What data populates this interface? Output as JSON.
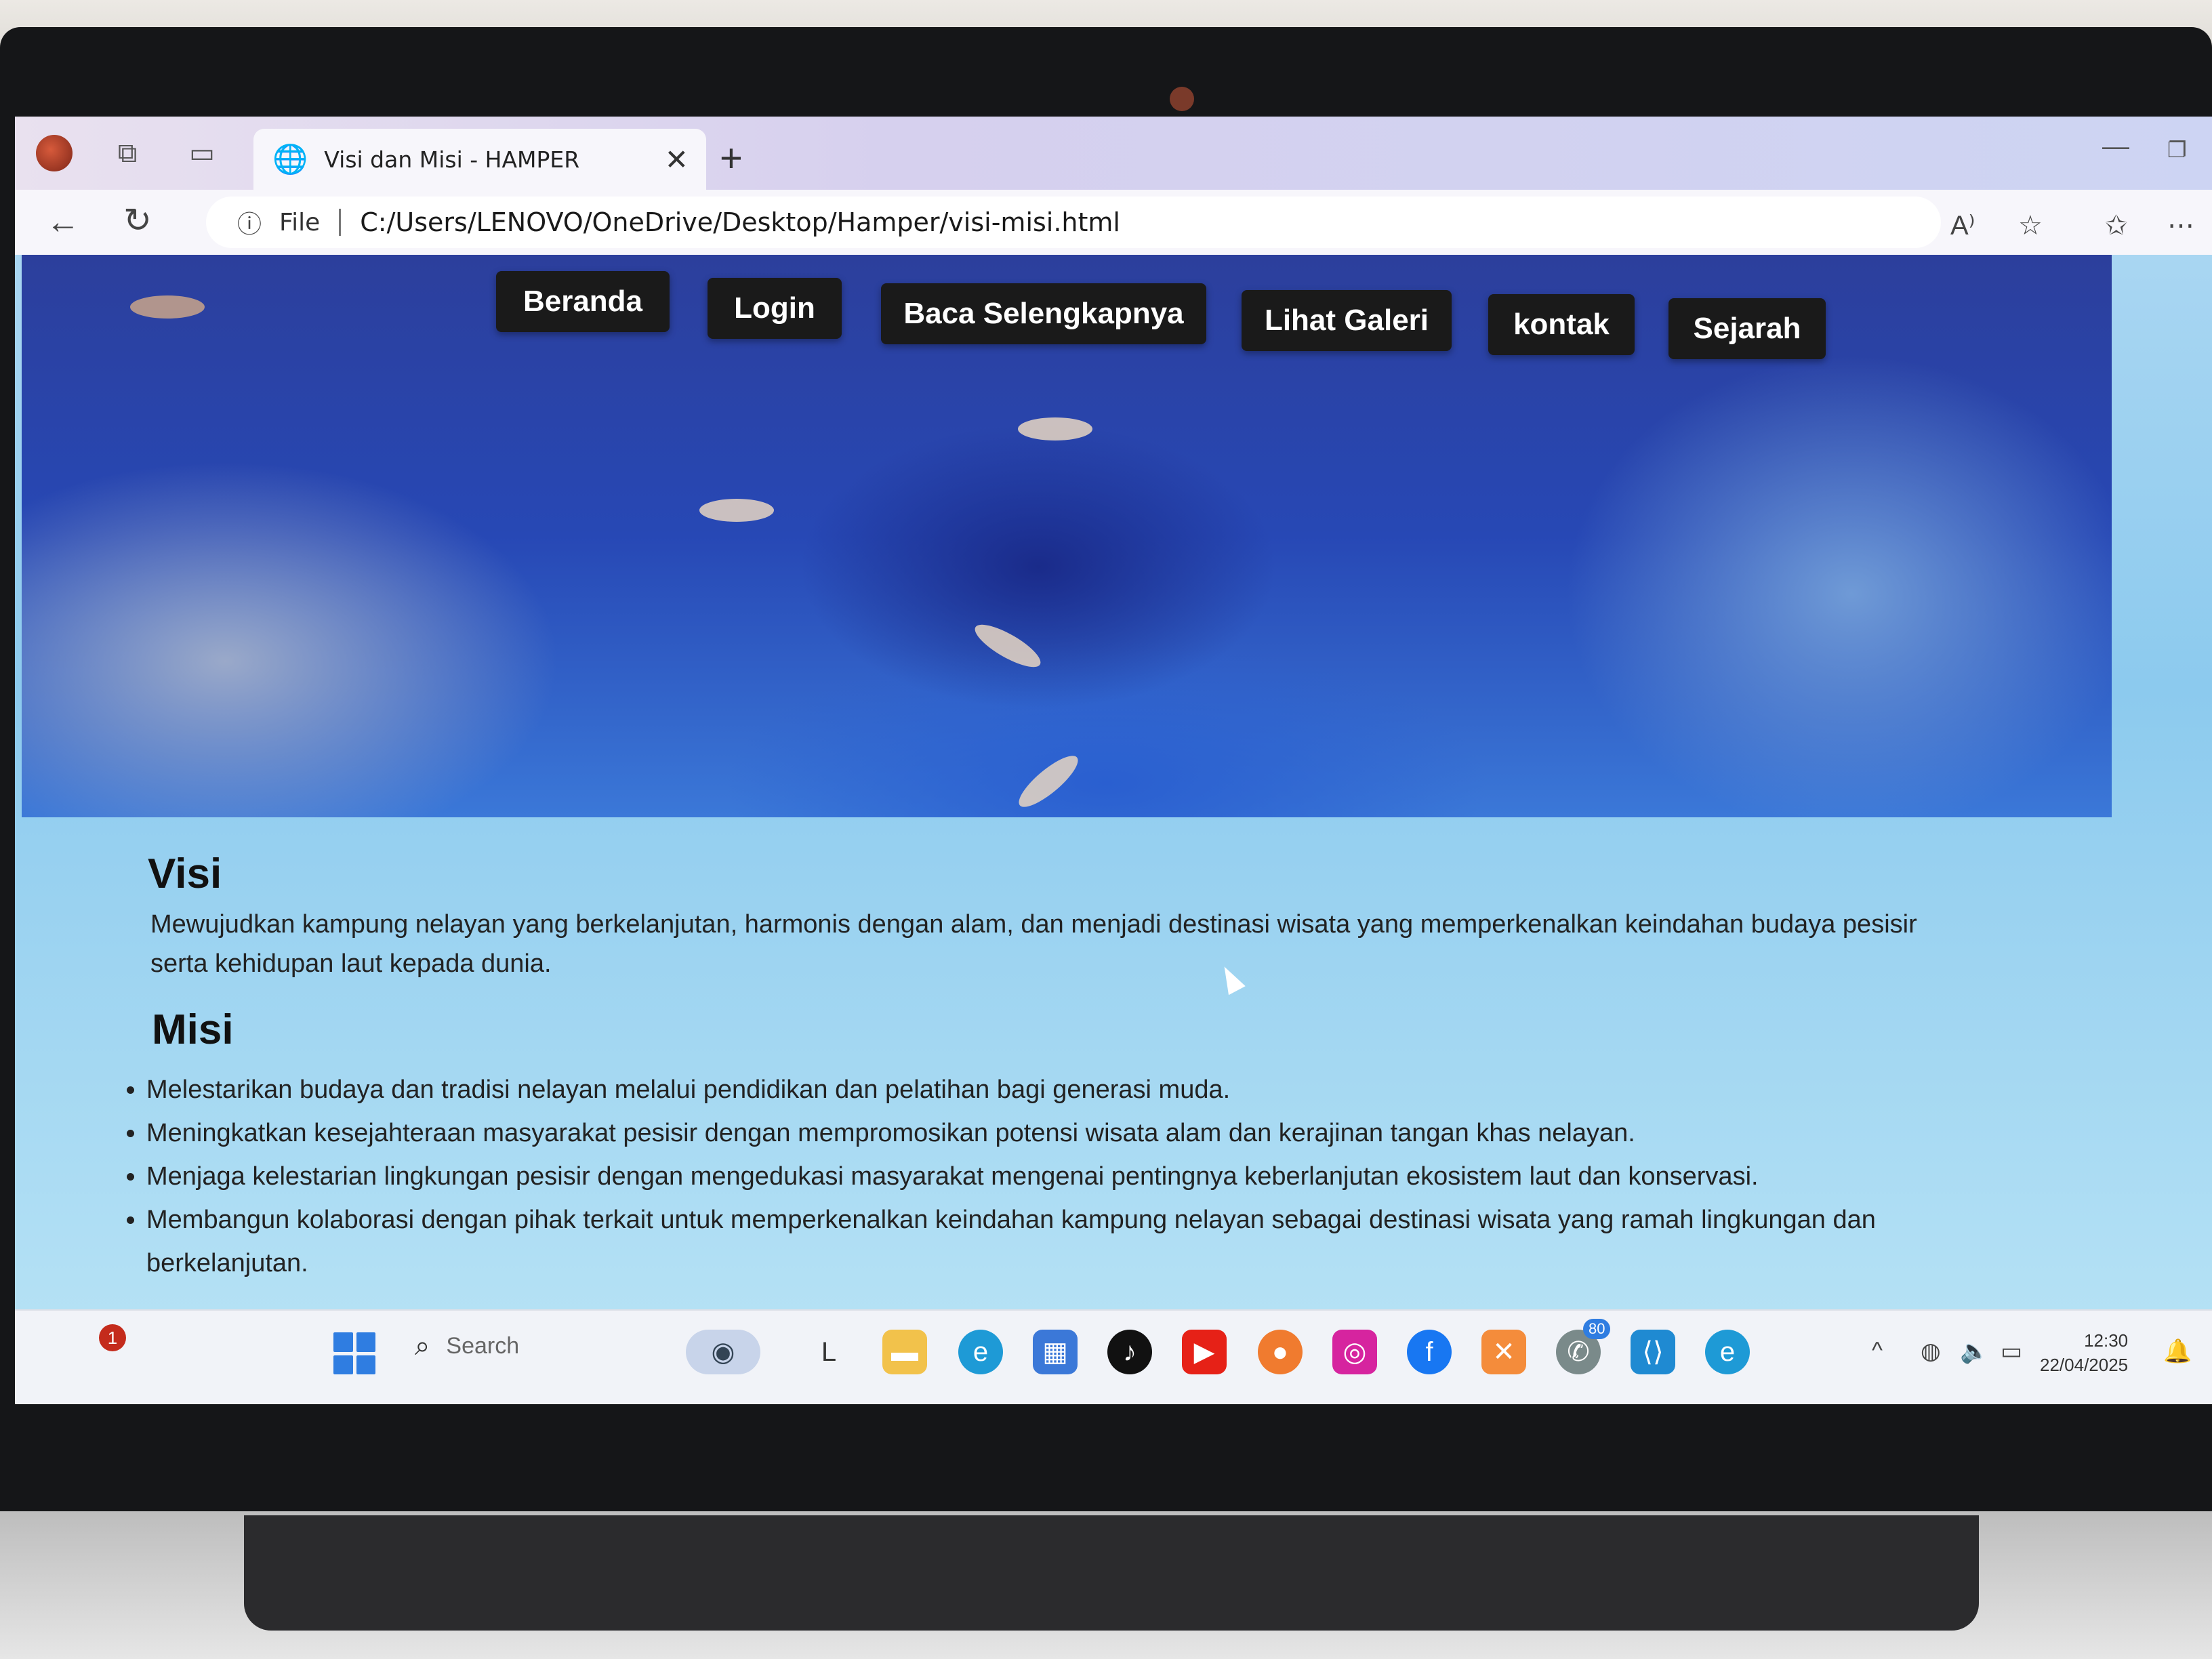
{
  "browser": {
    "tab_title": "Visi dan Misi - HAMPER",
    "scheme_label": "File",
    "url": "C:/Users/LENOVO/OneDrive/Desktop/Hamper/visi-misi.html"
  },
  "nav": {
    "items": [
      {
        "label": "Beranda"
      },
      {
        "label": "Login"
      },
      {
        "label": "Baca Selengkapnya"
      },
      {
        "label": "Lihat Galeri"
      },
      {
        "label": "kontak"
      },
      {
        "label": "Sejarah"
      }
    ]
  },
  "visi": {
    "heading": "Visi",
    "text_line1": "Mewujudkan kampung nelayan yang berkelanjutan, harmonis dengan alam, dan menjadi destinasi wisata yang memperkenalkan keindahan budaya pesisir",
    "text_line2": "serta kehidupan laut kepada dunia."
  },
  "misi": {
    "heading": "Misi",
    "items": [
      "Melestarikan budaya dan tradisi nelayan melalui pendidikan dan pelatihan bagi generasi muda.",
      "Meningkatkan kesejahteraan masyarakat pesisir dengan mempromosikan potensi wisata alam dan kerajinan tangan khas nelayan.",
      "Menjaga kelestarian lingkungan pesisir dengan mengedukasi masyarakat mengenai pentingnya keberlanjutan ekosistem laut dan konservasi.",
      "Membangun kolaborasi dengan pihak terkait untuk memperkenalkan keindahan kampung nelayan sebagai destinasi wisata yang ramah lingkungan dan berkelanjutan."
    ]
  },
  "taskbar": {
    "notification_count": "1",
    "search_label": "Search",
    "whatsapp_badge": "80",
    "time": "12:30",
    "date": "22/04/2025"
  }
}
